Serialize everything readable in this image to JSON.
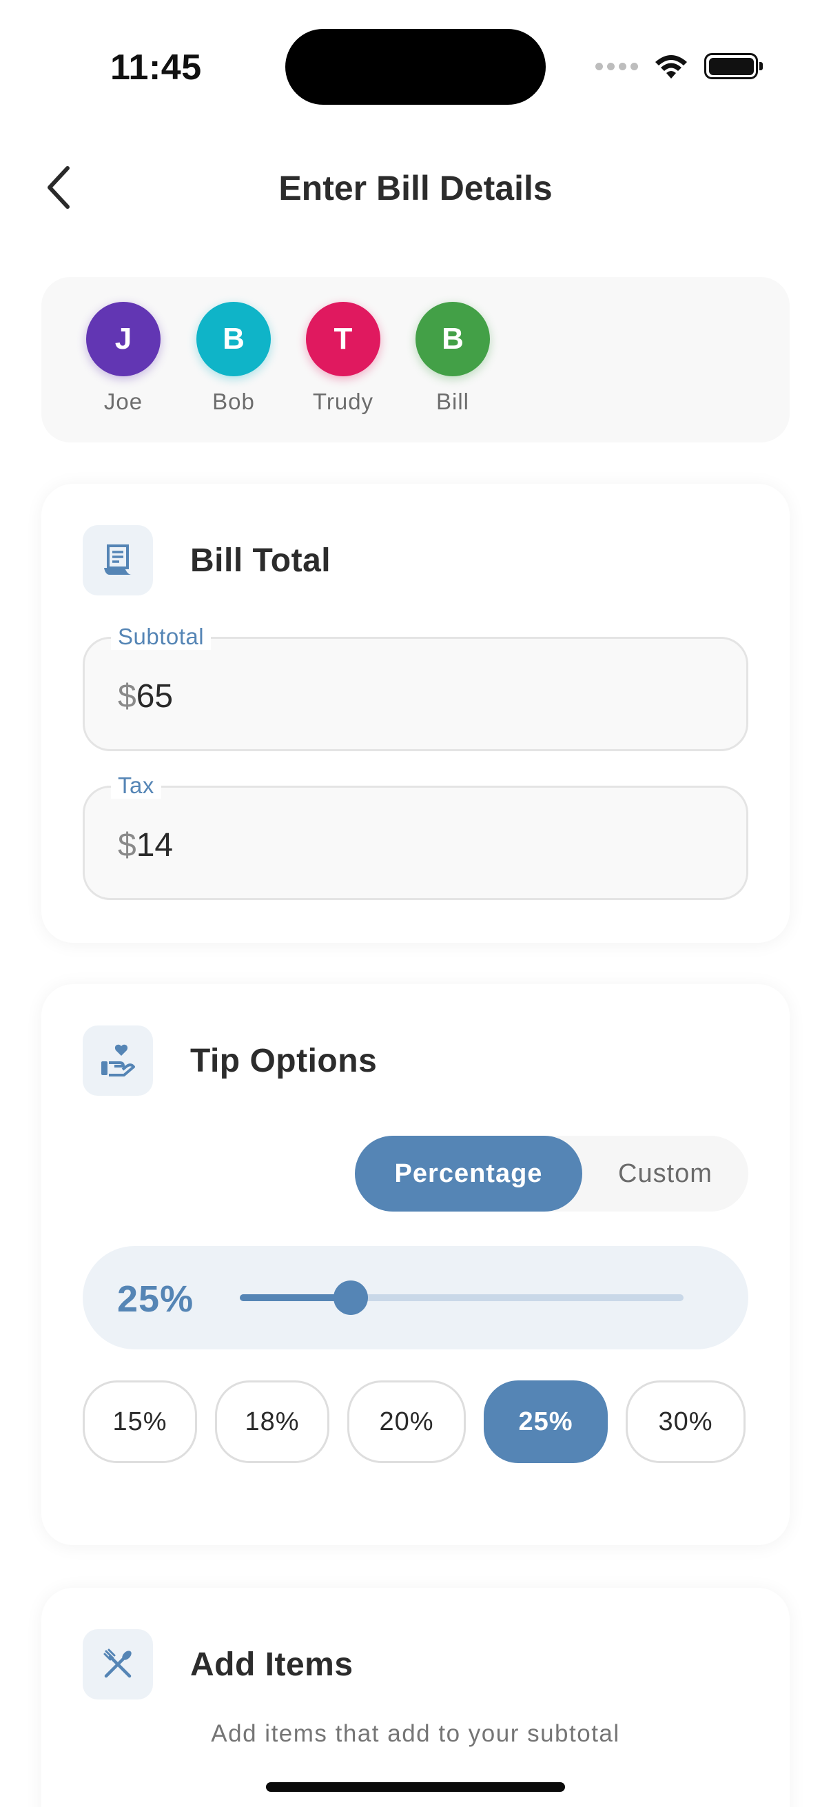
{
  "status_bar": {
    "time": "11:45"
  },
  "header": {
    "title": "Enter Bill Details"
  },
  "participants": [
    {
      "initial": "J",
      "name": "Joe",
      "color": "#6236b3"
    },
    {
      "initial": "B",
      "name": "Bob",
      "color": "#0fb4c8"
    },
    {
      "initial": "T",
      "name": "Trudy",
      "color": "#e0195f"
    },
    {
      "initial": "B",
      "name": "Bill",
      "color": "#43a047"
    }
  ],
  "bill_total": {
    "title": "Bill Total",
    "subtotal": {
      "label": "Subtotal",
      "currency": "$",
      "value": "65"
    },
    "tax": {
      "label": "Tax",
      "currency": "$",
      "value": "14"
    }
  },
  "tip_options": {
    "title": "Tip Options",
    "modes": [
      "Percentage",
      "Custom"
    ],
    "selected_mode": "Percentage",
    "slider": {
      "display": "25%",
      "value": 25,
      "min": 0,
      "max": 100
    },
    "presets": [
      "15%",
      "18%",
      "20%",
      "25%",
      "30%"
    ],
    "selected_preset": "25%"
  },
  "add_items": {
    "title": "Add Items",
    "subtitle": "Add items that add to your subtotal"
  },
  "colors": {
    "accent": "#5585b5",
    "accent_light": "#edf2f7"
  }
}
